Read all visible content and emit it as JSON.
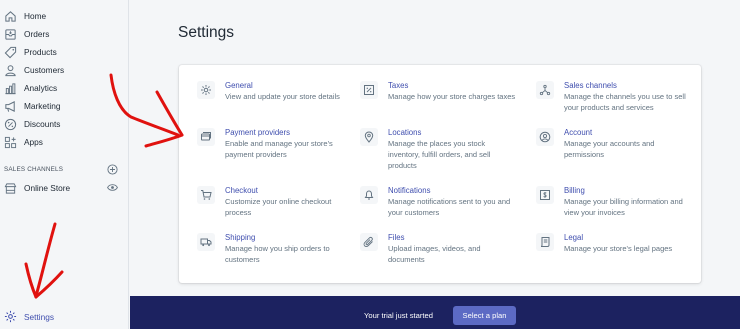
{
  "sidebar": {
    "items": [
      {
        "label": "Home",
        "icon": "home-icon"
      },
      {
        "label": "Orders",
        "icon": "orders-icon"
      },
      {
        "label": "Products",
        "icon": "tag-icon"
      },
      {
        "label": "Customers",
        "icon": "person-icon"
      },
      {
        "label": "Analytics",
        "icon": "bar-chart-icon"
      },
      {
        "label": "Marketing",
        "icon": "megaphone-icon"
      },
      {
        "label": "Discounts",
        "icon": "discount-icon"
      },
      {
        "label": "Apps",
        "icon": "apps-icon"
      }
    ],
    "sales_channels_header": "SALES CHANNELS",
    "online_store": {
      "label": "Online Store",
      "icon": "store-icon"
    },
    "settings": {
      "label": "Settings",
      "icon": "gear-icon"
    }
  },
  "main": {
    "title": "Settings",
    "tiles": [
      {
        "title": "General",
        "desc": "View and update your store details",
        "icon": "gear-icon"
      },
      {
        "title": "Taxes",
        "desc": "Manage how your store charges taxes",
        "icon": "percent-icon"
      },
      {
        "title": "Sales channels",
        "desc": "Manage the channels you use to sell your products and services",
        "icon": "channels-icon"
      },
      {
        "title": "Payment providers",
        "desc": "Enable and manage your store's payment providers",
        "icon": "payment-icon"
      },
      {
        "title": "Locations",
        "desc": "Manage the places you stock inventory, fulfill orders, and sell products",
        "icon": "location-pin-icon"
      },
      {
        "title": "Account",
        "desc": "Manage your accounts and permissions",
        "icon": "account-icon"
      },
      {
        "title": "Checkout",
        "desc": "Customize your online checkout process",
        "icon": "cart-icon"
      },
      {
        "title": "Notifications",
        "desc": "Manage notifications sent to you and your customers",
        "icon": "bell-icon"
      },
      {
        "title": "Billing",
        "desc": "Manage your billing information and view your invoices",
        "icon": "billing-icon"
      },
      {
        "title": "Shipping",
        "desc": "Manage how you ship orders to customers",
        "icon": "truck-icon"
      },
      {
        "title": "Files",
        "desc": "Upload images, videos, and documents",
        "icon": "paperclip-icon"
      },
      {
        "title": "Legal",
        "desc": "Manage your store's legal pages",
        "icon": "legal-icon"
      }
    ]
  },
  "trial": {
    "text": "Your trial just started",
    "button": "Select a plan"
  },
  "colors": {
    "link": "#3f4eae",
    "trial_bar": "#1c2260",
    "plan_button": "#5c6ac4",
    "annotation_arrow": "#e0120f"
  }
}
